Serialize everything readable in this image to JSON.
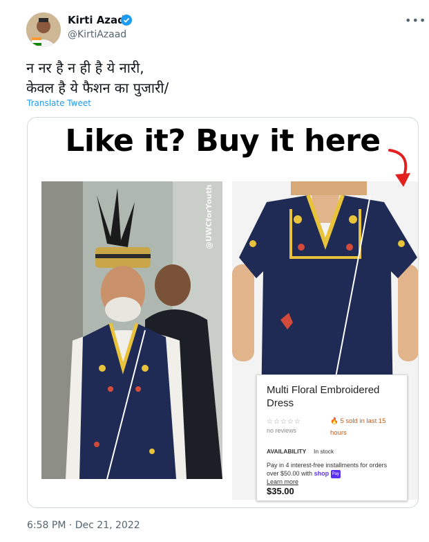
{
  "author": {
    "name": "Kirti Azad",
    "handle": "@KirtiAzaad"
  },
  "tweet": {
    "text": "न नर है न ही है ये नारी,\nकेवल है ये फैशन का पुजारी/",
    "translate_label": "Translate Tweet",
    "timestamp": "6:58 PM · Dec 21, 2022"
  },
  "media": {
    "headline": "Like it? Buy it here",
    "watermark": "@UWCforYouth",
    "product_card": {
      "title": "Multi Floral Embroidered Dress",
      "stars": "☆☆☆☆☆",
      "reviews": "no reviews",
      "sold": "5 sold in last 15 hours",
      "availability_label": "AVAILABILITY",
      "availability_value": "In stock",
      "pay_text": "Pay in 4 interest-free installments for orders over $50.00 with",
      "shop_label": "shop",
      "pay_badge": "Pay",
      "learn_more": "Learn more",
      "price": "$35.00"
    }
  },
  "colors": {
    "link": "#1d9bf0",
    "verified": "#1d9bf0",
    "dress_navy": "#1f2a55",
    "arrow_red": "#e22020"
  }
}
